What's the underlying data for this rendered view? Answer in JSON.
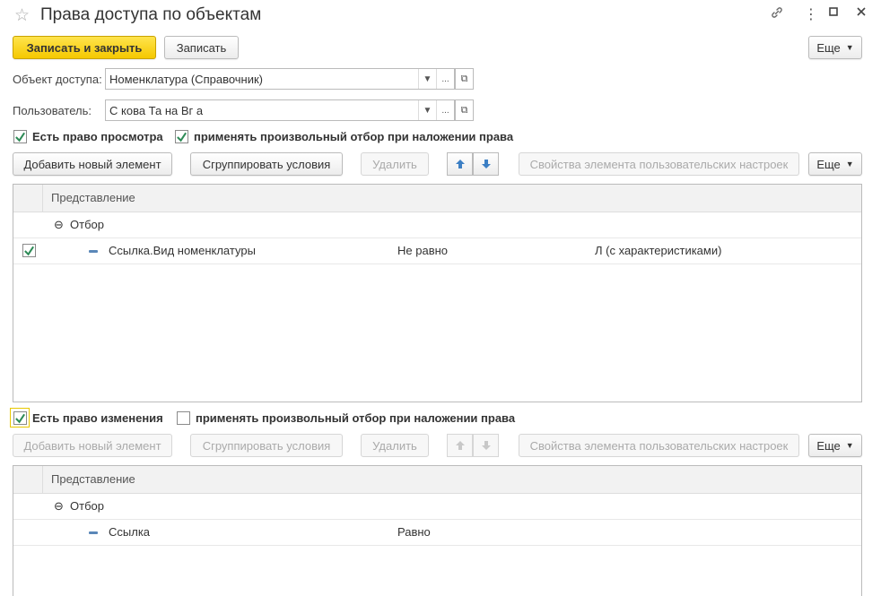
{
  "window": {
    "title": "Права доступа по объектам",
    "icons": [
      "star-icon",
      "link-icon",
      "more-vert-icon",
      "minimize-icon",
      "maximize-icon",
      "close-icon"
    ]
  },
  "toolbar": {
    "save_close_label": "Записать и закрыть",
    "save_label": "Записать",
    "more_label": "Еще"
  },
  "form": {
    "object_label": "Объект доступа:",
    "object_value": "Номенклатура (Справочник)",
    "user_label": "Пользователь:",
    "user_value": "С         кова Та     на Вг                  а"
  },
  "view_section": {
    "checkbox_label": "Есть право просмотра",
    "checked": true,
    "filter_checkbox_label": "применять произвольный отбор при наложении права",
    "filter_checked": true,
    "buttons": {
      "add": "Добавить новый элемент",
      "group": "Сгруппировать условия",
      "delete": "Удалить",
      "props": "Свойства элемента пользовательских настроек",
      "more": "Еще"
    },
    "grid": {
      "header": "Представление",
      "group_label": "Отбор",
      "rows": [
        {
          "field": "Ссылка.Вид номенклатуры",
          "condition": "Не равно",
          "value": "Л        (с характеристиками)",
          "checked": true
        }
      ]
    }
  },
  "edit_section": {
    "checkbox_label": "Есть право изменения",
    "checked": true,
    "filter_checkbox_label": "применять произвольный отбор при наложении права",
    "filter_checked": false,
    "buttons": {
      "add": "Добавить новый элемент",
      "group": "Сгруппировать условия",
      "delete": "Удалить",
      "props": "Свойства элемента пользовательских настроек",
      "more": "Еще"
    },
    "grid": {
      "header": "Представление",
      "group_label": "Отбор",
      "rows": [
        {
          "field": "Ссылка",
          "condition": "Равно",
          "value": ""
        }
      ]
    }
  },
  "colors": {
    "primary_button": "#f5c800",
    "check_green": "#2e8b57",
    "arrow_blue": "#3c7fc4"
  }
}
